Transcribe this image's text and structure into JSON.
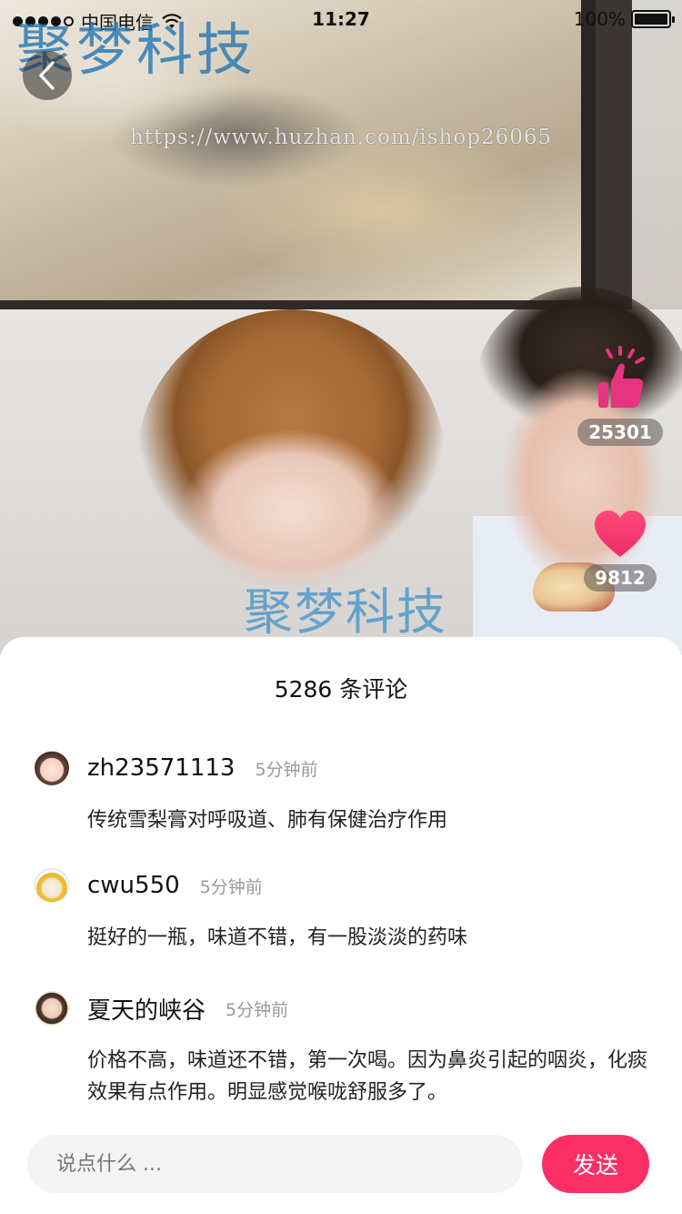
{
  "status_bar": {
    "carrier": "中国电信",
    "time": "11:27",
    "battery": "100%",
    "battery_level": 1.0
  },
  "watermarks": {
    "top": "聚梦科技",
    "middle": "聚梦科技",
    "url": "https://www.huzhan.com/ishop26065"
  },
  "actions": {
    "like_count": "25301",
    "favorite_count": "9812"
  },
  "comments_panel": {
    "title": "5286 条评论",
    "comments": [
      {
        "username": "zh23571113",
        "time": "5分钟前",
        "text": "传统雪梨膏对呼吸道、肺有保健治疗作用"
      },
      {
        "username": "cwu550",
        "time": "5分钟前",
        "text": "挺好的一瓶，味道不错，有一股淡淡的药味"
      },
      {
        "username": "夏天的峡谷",
        "time": "5分钟前",
        "text": "价格不高，味道还不错，第一次喝。因为鼻炎引起的咽炎，化痰效果有点作用。明显感觉喉咙舒服多了。"
      }
    ]
  },
  "input_bar": {
    "placeholder": "说点什么 ...",
    "send_label": "发送"
  },
  "colors": {
    "accent": "#fb2f64",
    "like_icon": "#e8337f",
    "heart_icon": "#f2356f"
  },
  "icons": [
    "back-icon",
    "thumbs-up-icon",
    "heart-icon",
    "wifi-icon",
    "battery-icon"
  ]
}
